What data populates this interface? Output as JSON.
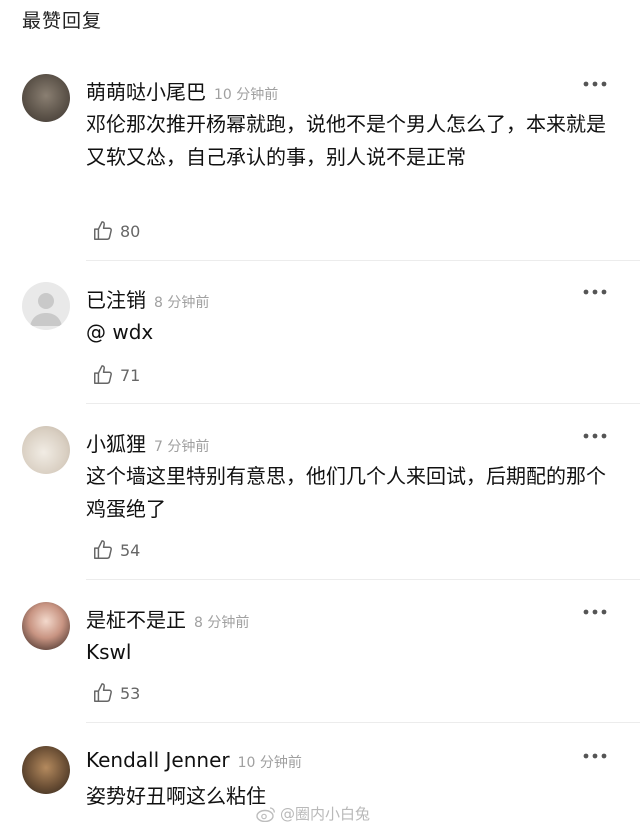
{
  "section_title": "最赞回复",
  "comments": [
    {
      "username": "萌萌哒小尾巴",
      "time": "10 分钟前",
      "text": "邓伦那次推开杨幂就跑，说他不是个男人怎么了，本来就是又软又怂，自己承认的事，别人说不是正常",
      "likes": "80"
    },
    {
      "username": "已注销",
      "time": "8 分钟前",
      "text": "@ wdx",
      "likes": "71"
    },
    {
      "username": "小狐狸",
      "time": "7 分钟前",
      "text": "这个墙这里特别有意思，他们几个人来回试，后期配的那个鸡蛋绝了",
      "likes": "54"
    },
    {
      "username": "是柾不是正",
      "time": "8 分钟前",
      "text": "Kswl",
      "likes": "53"
    },
    {
      "username": "Kendall Jenner",
      "time": "10 分钟前",
      "text": "姿势好丑啊这么粘住",
      "likes": ""
    }
  ],
  "watermark": "@圈内小白兔",
  "icons": {
    "more": "more-icon",
    "like": "thumbs-up-icon"
  }
}
